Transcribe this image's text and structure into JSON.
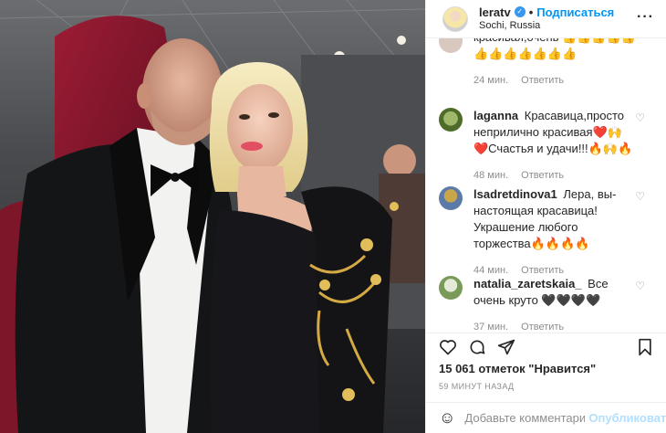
{
  "header": {
    "username": "leratv",
    "verified_glyph": "✓",
    "separator": "•",
    "follow_label": "Подписаться",
    "location": "Sochi, Russia",
    "more_icon": "more-icon"
  },
  "comments": [
    {
      "user": "",
      "text": "красивая,очень 👍👍👍👍👍👍👍👍👍👍👍👍",
      "time": "24 мин.",
      "reply": "Ответить"
    },
    {
      "user": "laganna",
      "text": "Красавица,просто неприлично красивая❤️🙌 ❤️Счастья и удачи!!!🔥🙌🔥",
      "time": "48 мин.",
      "reply": "Ответить"
    },
    {
      "user": "lsadretdinova1",
      "text": "Лера, вы-настоящая красавица! Украшение любого торжества🔥🔥🔥🔥",
      "time": "44 мин.",
      "reply": "Ответить"
    },
    {
      "user": "natalia_zaretskaia_",
      "text": "Все очень круто 🖤🖤🖤🖤",
      "time": "37 мин.",
      "reply": "Ответить"
    }
  ],
  "actions": {
    "like_icon": "heart-icon",
    "comment_icon": "comment-icon",
    "share_icon": "share-icon",
    "save_icon": "bookmark-icon"
  },
  "likes": "15 061 отметок \"Нравится\"",
  "time_ago": "59 МИНУТ НАЗАД",
  "add_comment": {
    "emoji": "☺",
    "placeholder": "Добавьте комментарий...",
    "post_label": "Опубликовать"
  },
  "colors": {
    "accent": "#0095f6",
    "muted": "#8e8e8e",
    "border": "#efefef"
  }
}
